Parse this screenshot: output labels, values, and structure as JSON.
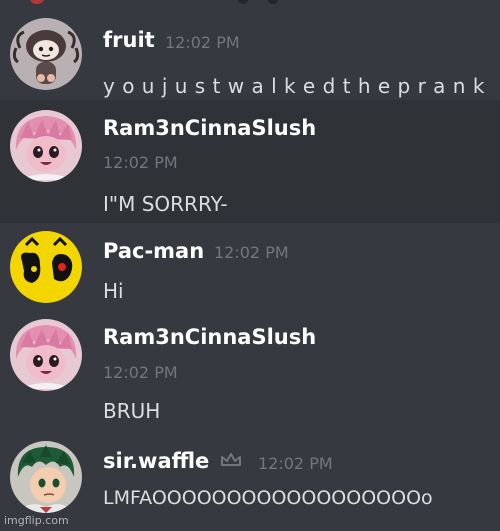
{
  "messages": [
    {
      "username": "fruit",
      "timestamp": "12:02 PM",
      "content": "y o u j u s t w a l k e d t h e p r a n k",
      "avatar": "spider-girl-avatar"
    },
    {
      "username": "Ram3nCinnaSlush",
      "timestamp": "12:02 PM",
      "content": "I\"M SORRRY-",
      "avatar": "pink-hair-girl-avatar"
    },
    {
      "username": "Pac-man",
      "timestamp": "12:02 PM",
      "content": "Hi",
      "avatar": "pacman-avatar"
    },
    {
      "username": "Ram3nCinnaSlush",
      "timestamp": "12:02 PM",
      "content": "BRUH",
      "avatar": "pink-hair-girl-avatar"
    },
    {
      "username": "sir.waffle",
      "timestamp": "12:02 PM",
      "content": "LMFAOOOOOOOOOOOOOOOOOOo",
      "avatar": "green-hair-boy-avatar",
      "badge": "crown-icon"
    }
  ],
  "colors": {
    "background": "#36393f",
    "highlight": "#2f3237",
    "username": "#ffffff",
    "timestamp": "#72767d",
    "text": "#dcddde"
  },
  "watermark": "imgflip.com"
}
